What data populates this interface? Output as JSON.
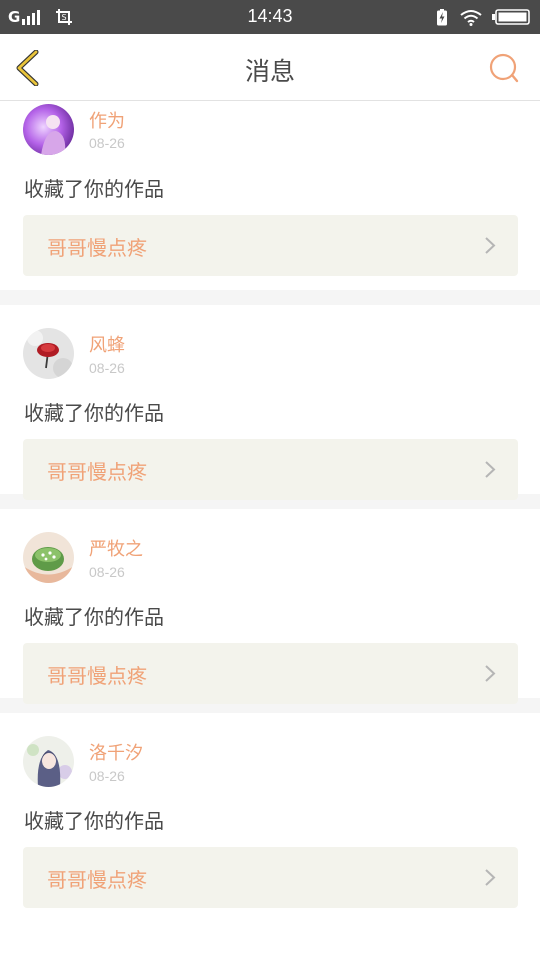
{
  "status_bar": {
    "carrier": "G",
    "time": "14:43",
    "icons": [
      "signal-icon",
      "screenshot-icon",
      "charging-icon",
      "wifi-icon",
      "battery-icon"
    ]
  },
  "header": {
    "title": "消息",
    "back_icon": "chevron-left-icon",
    "search_icon": "search-icon",
    "colors": {
      "back": "#e9c43a",
      "search": "#f0a277"
    }
  },
  "colors": {
    "accent": "#f0a277",
    "text": "#4a4a4a",
    "date": "#c8c8c8",
    "link_background": "#f3f3ec",
    "separator": "#f5f5f5"
  },
  "messages": [
    {
      "user": "作为",
      "date": "08-26",
      "action": "收藏了你的作品",
      "work_title": "哥哥慢点疼"
    },
    {
      "user": "风蜂",
      "date": "08-26",
      "action": "收藏了你的作品",
      "work_title": "哥哥慢点疼"
    },
    {
      "user": "严牧之",
      "date": "08-26",
      "action": "收藏了你的作品",
      "work_title": "哥哥慢点疼"
    },
    {
      "user": "洛千汐",
      "date": "08-26",
      "action": "收藏了你的作品",
      "work_title": "哥哥慢点疼"
    }
  ]
}
